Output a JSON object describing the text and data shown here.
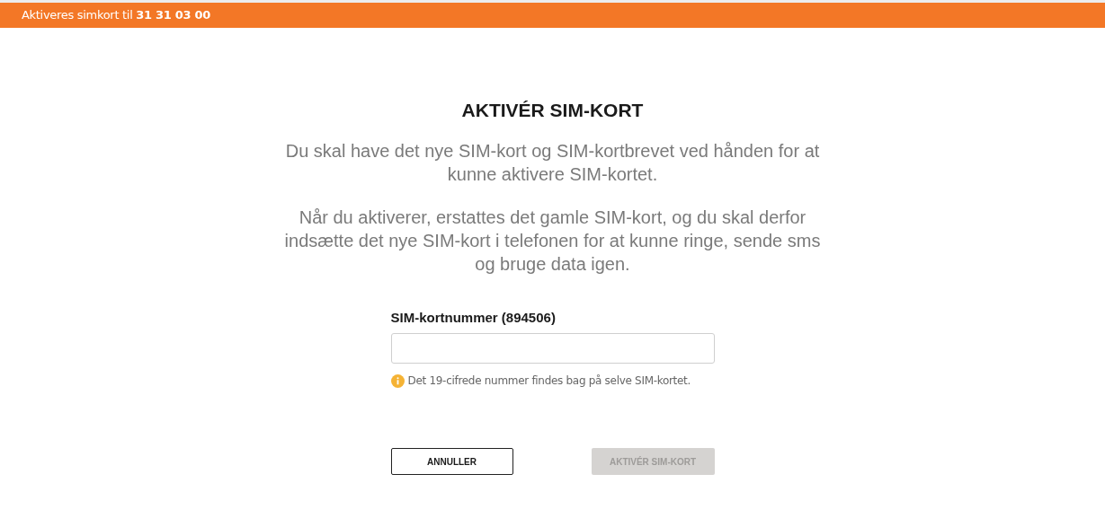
{
  "banner": {
    "text": "Aktiveres simkort til **31 31 03 00**"
  },
  "title": "AKTIVÉR SIM-KORT",
  "paragraphs": [
    "Du skal have det nye SIM-kort og SIM-kortbrevet ved hånden for at kunne aktivere SIM-kortet.",
    "Når du aktiverer, erstattes det gamle SIM-kort, og du skal derfor indsætte det nye SIM-kort i telefonen for at kunne ringe, sende sms og bruge data igen."
  ],
  "field": {
    "label": "SIM-kortnummer (894506)",
    "hint": "Det 19-cifrede nummer findes bag på selve SIM-kortet."
  },
  "buttons": [
    {
      "label": "ANNULLER",
      "disabled": false
    },
    {
      "label": "AKTIVÉR SIM-KORT",
      "disabled": true
    }
  ]
}
